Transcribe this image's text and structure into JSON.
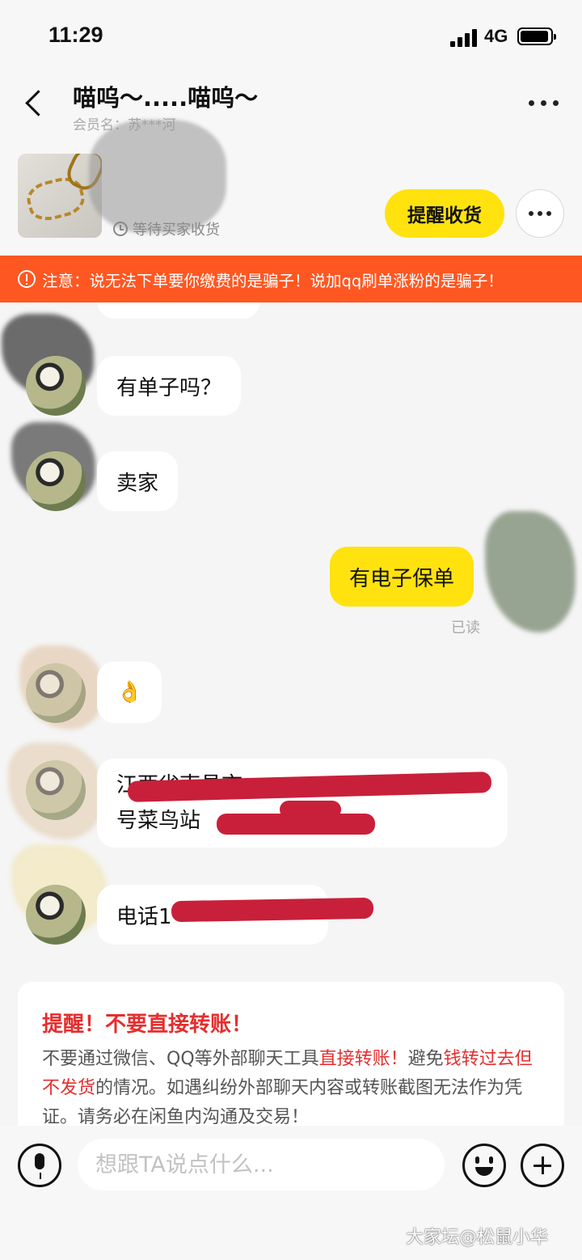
{
  "status_bar": {
    "time": "11:29",
    "network": "4G"
  },
  "header": {
    "title": "喵呜～.....喵呜～",
    "subtitle": "会员名：苏***河"
  },
  "order": {
    "status": "等待买家收货",
    "remind_button": "提醒收货"
  },
  "warning_banner": {
    "text": "注意：说无法下单要你缴费的是骗子！说加qq刷单涨粉的是骗子！"
  },
  "messages": [
    {
      "from": "buyer",
      "text": "有单子吗？"
    },
    {
      "from": "buyer",
      "text": "卖家"
    },
    {
      "from": "me",
      "text": "有电子保单",
      "receipt": "已读"
    },
    {
      "from": "buyer",
      "text": "👌"
    },
    {
      "from": "buyer",
      "line1": "江西省南昌市",
      "line2": "号菜鸟站"
    },
    {
      "from": "buyer",
      "text": "电话1"
    }
  ],
  "reminder": {
    "title": "提醒！不要直接转账！",
    "body_1": "不要通过微信、QQ等外部聊天工具",
    "body_2": "直接转账！",
    "body_3": "避免",
    "body_4": "钱转过去但不发货",
    "body_5": "的情况。如遇纠纷外部聊天内容或转账截图无法作为凭证。请务必在闲鱼内沟通及交易！"
  },
  "input": {
    "placeholder": "想跟TA说点什么..."
  },
  "watermark": "大家坛@松鼠小华",
  "colors": {
    "accent_yellow": "#ffe20e",
    "warning_orange": "#ff5722",
    "alert_red": "#e52e2e"
  }
}
